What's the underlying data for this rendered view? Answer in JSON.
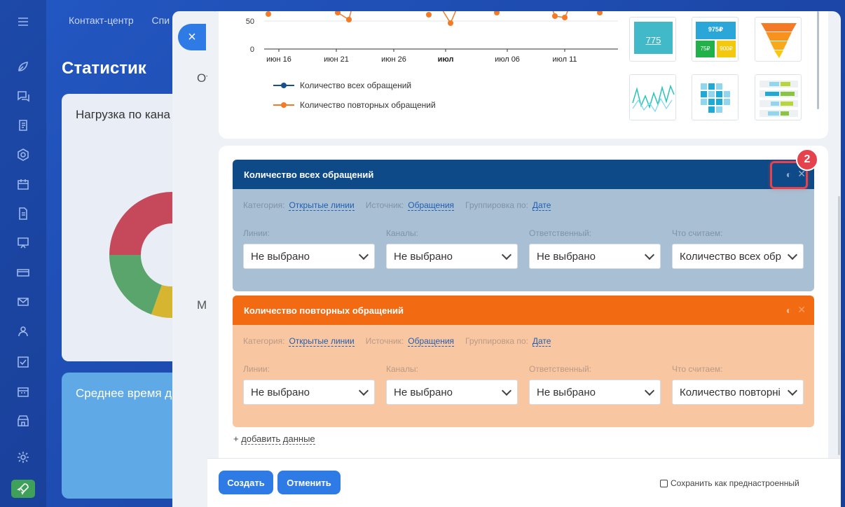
{
  "topnav": {
    "item1": "Контакт-центр",
    "item2": "Спи"
  },
  "page": {
    "title": "Статистик"
  },
  "bg_cards": {
    "load_title": "Нагрузка по кана",
    "avg_title": "Среднее время д"
  },
  "mid_panel": {
    "close": "×",
    "text1": "От",
    "text2": "М"
  },
  "chart": {
    "y_ticks": [
      "50",
      "0"
    ],
    "x_ticks": [
      "июн 16",
      "июн 21",
      "июн 26",
      "июл",
      "июл 06",
      "июл 11"
    ],
    "legend": {
      "all": "Количество всех обращений",
      "repeat": "Количество повторных обращений"
    },
    "colors": {
      "all": "#1a4f8b",
      "repeat": "#f47a25"
    }
  },
  "thumbnails": {
    "t1_value": "775",
    "t2_top": "975₽",
    "t2_a": "75₽",
    "t2_b": "900₽"
  },
  "blocks": [
    {
      "title": "Количество всех обращений",
      "filter_category_label": "Категория:",
      "filter_category": "Открытые линии",
      "filter_source_label": "Источник:",
      "filter_source": "Обращения",
      "filter_group_label": "Группировка по:",
      "filter_group": "Дате",
      "lines_label": "Линии:",
      "lines_value": "Не выбрано",
      "channels_label": "Каналы:",
      "channels_value": "Не выбрано",
      "resp_label": "Ответственный:",
      "resp_value": "Не выбрано",
      "count_label": "Что считаем:",
      "count_value": "Количество всех обр"
    },
    {
      "title": "Количество повторных обращений",
      "filter_category_label": "Категория:",
      "filter_category": "Открытые линии",
      "filter_source_label": "Источник:",
      "filter_source": "Обращения",
      "filter_group_label": "Группировка по:",
      "filter_group": "Дате",
      "lines_label": "Линии:",
      "lines_value": "Не выбрано",
      "channels_label": "Каналы:",
      "channels_value": "Не выбрано",
      "resp_label": "Ответственный:",
      "resp_value": "Не выбрано",
      "count_label": "Что считаем:",
      "count_value": "Количество повторні"
    }
  ],
  "step_badge": "2",
  "add_data": {
    "plus": "+",
    "label": "добавить данные"
  },
  "footer": {
    "create": "Создать",
    "cancel": "Отменить",
    "save_preset": "Сохранить как преднастроенный"
  }
}
